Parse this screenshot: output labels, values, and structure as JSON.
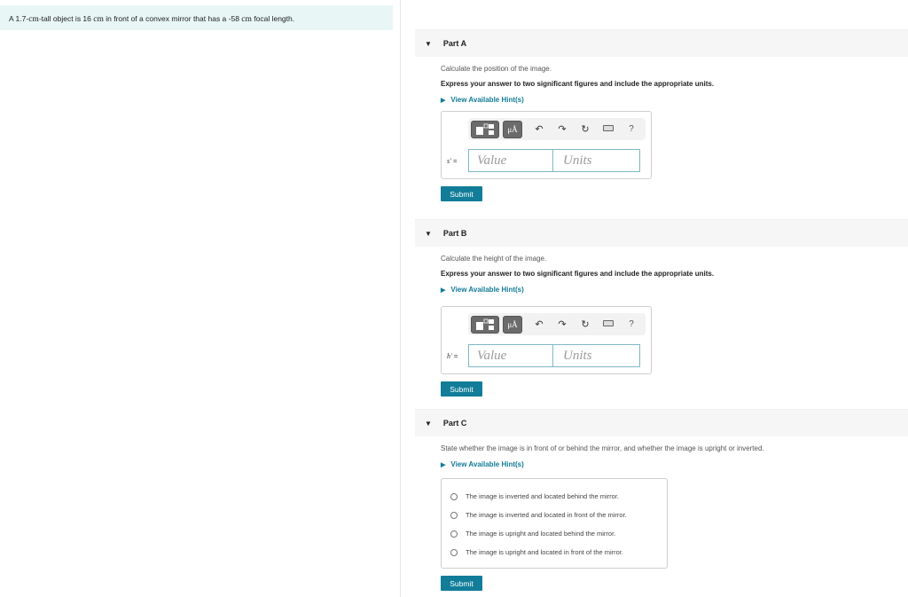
{
  "problem": {
    "segments": [
      {
        "text": "A 1.7-",
        "unit": false
      },
      {
        "text": "cm",
        "unit": true
      },
      {
        "text": "-tall object is 16 ",
        "unit": false
      },
      {
        "text": "cm",
        "unit": true
      },
      {
        "text": " in front of a convex mirror that has a -58 ",
        "unit": false
      },
      {
        "text": "cm",
        "unit": true
      },
      {
        "text": " focal length.",
        "unit": false
      }
    ]
  },
  "parts": {
    "a": {
      "title": "Part A",
      "instruction": "Calculate the position of the image.",
      "emphasis": "Express your answer to two significant figures and include the appropriate units.",
      "hint": "View Available Hint(s)",
      "var_symbol": "s′",
      "equals": "=",
      "value_placeholder": "Value",
      "units_placeholder": "Units",
      "submit": "Submit"
    },
    "b": {
      "title": "Part B",
      "instruction": "Calculate the height of the image.",
      "emphasis": "Express your answer to two significant figures and include the appropriate units.",
      "hint": "View Available Hint(s)",
      "var_symbol": "h′",
      "equals": "=",
      "value_placeholder": "Value",
      "units_placeholder": "Units",
      "submit": "Submit"
    },
    "c": {
      "title": "Part C",
      "instruction": "State whether the image is in front of or behind the mirror, and whether the image is upright or inverted.",
      "hint": "View Available Hint(s)",
      "options": [
        "The image is inverted and located behind the mirror.",
        "The image is inverted and located in front of the mirror.",
        "The image is upright and located behind the mirror.",
        "The image is upright and located in front of the mirror."
      ],
      "submit": "Submit"
    }
  },
  "toolbar": {
    "units_label": "μÅ",
    "undo": "↶",
    "redo": "↷",
    "reset": "↻",
    "help": "?"
  },
  "icons": {
    "collapse": "▼",
    "expand": "▶"
  },
  "colors": {
    "accent": "#117d99",
    "link": "#127a98",
    "problem_bg": "#e8f6f6",
    "header_bg": "#f6f6f6"
  }
}
